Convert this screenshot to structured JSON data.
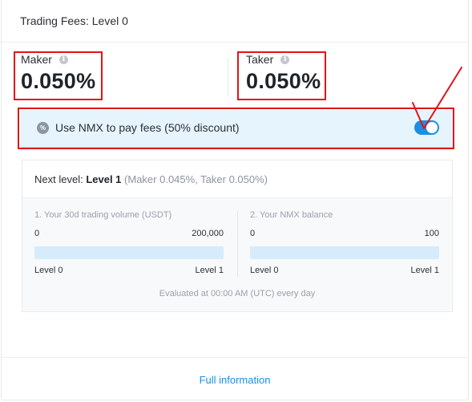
{
  "header": {
    "title": "Trading Fees: Level 0"
  },
  "fees": {
    "maker": {
      "label": "Maker",
      "value": "0.050%"
    },
    "taker": {
      "label": "Taker",
      "value": "0.050%"
    }
  },
  "discount": {
    "icon": "percent-icon",
    "label": "Use NMX to pay fees (50% discount)",
    "toggle_on": true
  },
  "next_level": {
    "prefix": "Next level:",
    "value": "Level 1",
    "detail": "(Maker 0.045%, Taker 0.050%)"
  },
  "metrics": [
    {
      "title": "1. Your 30d trading volume (USDT)",
      "min": "0",
      "max": "200,000",
      "progress": 0,
      "level_from": "Level 0",
      "level_to": "Level 1"
    },
    {
      "title": "2. Your NMX balance",
      "min": "0",
      "max": "100",
      "progress": 0,
      "level_from": "Level 0",
      "level_to": "Level 1"
    }
  ],
  "evaluated_note": "Evaluated at 00:00 AM (UTC) every day",
  "footer": {
    "link_label": "Full information"
  },
  "colors": {
    "accent": "#1a8fe3",
    "annotation_red": "#e0141b",
    "discount_bg": "#e6f4fd"
  }
}
